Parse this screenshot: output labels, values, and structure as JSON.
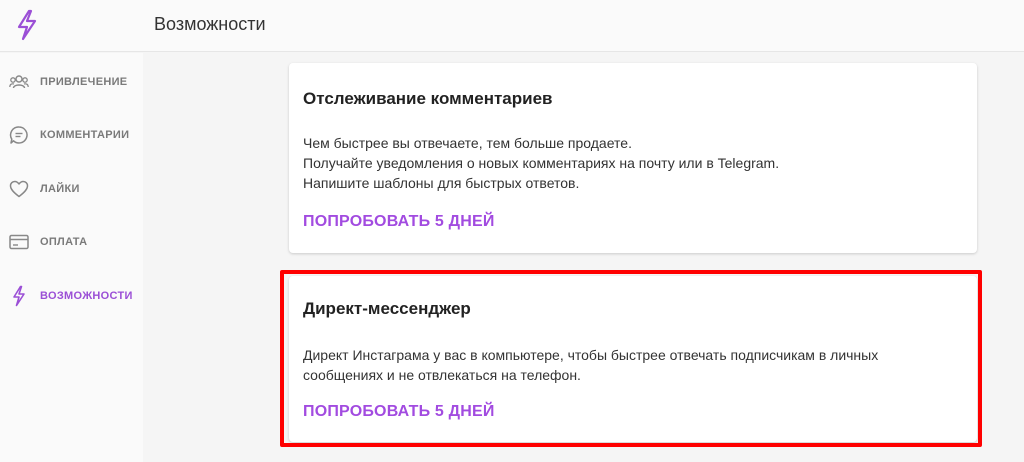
{
  "header": {
    "title": "Возможности",
    "logo_icon": "lightning-icon"
  },
  "sidebar": {
    "items": [
      {
        "label": "ПРИВЛЕЧЕНИЕ",
        "icon": "users-icon",
        "active": false
      },
      {
        "label": "КОММЕНТАРИИ",
        "icon": "comment-icon",
        "active": false
      },
      {
        "label": "ЛАЙКИ",
        "icon": "heart-icon",
        "active": false
      },
      {
        "label": "ОПЛАТА",
        "icon": "card-icon",
        "active": false
      },
      {
        "label": "ВОЗМОЖНОСТИ",
        "icon": "lightning-icon",
        "active": true
      }
    ]
  },
  "cards": [
    {
      "title": "Отслеживание комментариев",
      "lines": [
        "Чем быстрее вы отвечаете, тем больше продаете.",
        "Получайте уведомления о новых комментариях на почту или в Telegram.",
        "Напишите шаблоны для быстрых ответов."
      ],
      "action": "ПОПРОБОВАТЬ 5 ДНЕЙ"
    },
    {
      "title": "Директ-мессенджер",
      "lines": [
        "Директ Инстаграма у вас в компьютере, чтобы быстрее отвечать подписчикам в личных",
        "сообщениях и не отвлекаться на телефон."
      ],
      "action": "ПОПРОБОВАТЬ 5 ДНЕЙ",
      "highlighted": true
    }
  ],
  "colors": {
    "accent": "#a24be0",
    "highlight": "#ff0000"
  }
}
